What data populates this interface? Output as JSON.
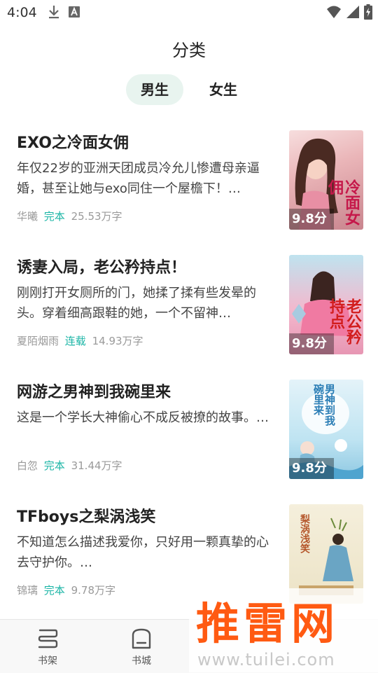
{
  "status_bar": {
    "time": "4:04"
  },
  "header": {
    "title": "分类"
  },
  "tabs": [
    {
      "label": "男生",
      "active": true
    },
    {
      "label": "女生",
      "active": false
    }
  ],
  "books": [
    {
      "title": "EXO之冷面女佣",
      "description": "年仅22岁的亚洲天团成员冷允儿惨遭母亲逼婚，甚至让她与exo同住一个屋檐下！…",
      "author": "华曦",
      "status": "完本",
      "word_count": "25.53万字",
      "score": "9.8分",
      "cover_text": "冷面女佣"
    },
    {
      "title": "诱妻入局，老公矜持点！",
      "description": "刚刚打开女厕所的门，她揉了揉有些发晕的头。穿着细高跟鞋的她，一个不留神…",
      "author": "夏陌烟雨",
      "status": "连载",
      "word_count": "14.93万字",
      "score": "9.8分",
      "cover_text": "老公矜持点"
    },
    {
      "title": "网游之男神到我碗里来",
      "description": "这是一个学长大神偷心不成反被撩的故事。…",
      "author": "白忽",
      "status": "完本",
      "word_count": "31.44万字",
      "score": "9.8分",
      "cover_text": "男神到我碗里来"
    },
    {
      "title": "TFboys之梨涡浅笑",
      "description": "不知道怎么描述我爱你，只好用一颗真挚的心去守护你。…",
      "author": "锦璃",
      "status": "完本",
      "word_count": "9.78万字",
      "score": "",
      "cover_text": "梨涡浅笑"
    }
  ],
  "bottom_nav": [
    {
      "label": "书架",
      "icon": "bookshelf-icon"
    },
    {
      "label": "书城",
      "icon": "bookstore-icon"
    }
  ],
  "watermark": {
    "text": "推雷网",
    "url": "www.tuilei.com"
  },
  "colors": {
    "accent": "#1bb5a6",
    "tab_active_bg": "#e8f4ef",
    "watermark": "#ff5a12"
  }
}
